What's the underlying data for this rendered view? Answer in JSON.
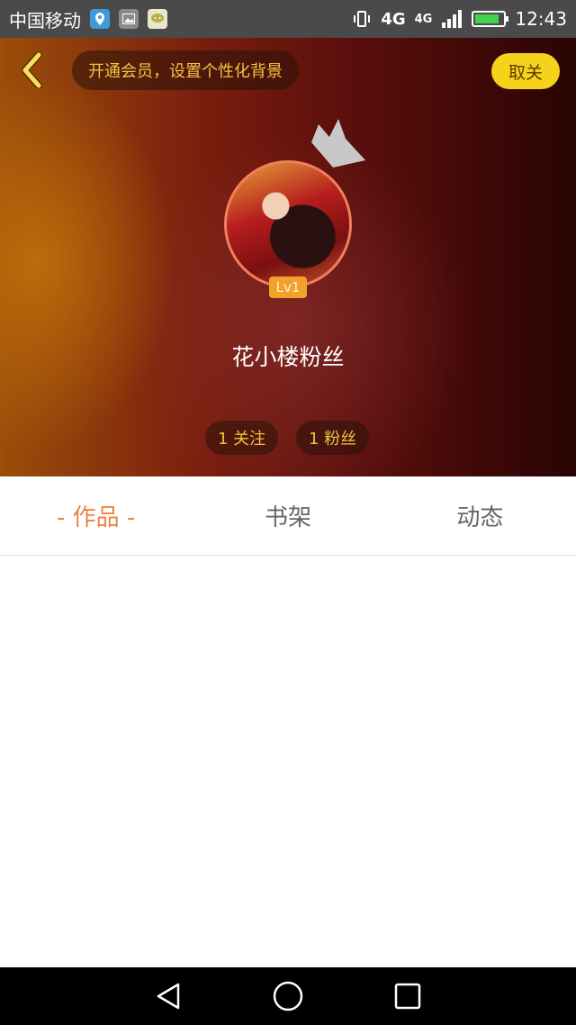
{
  "status_bar": {
    "carrier": "中国移动",
    "network_1": "4G",
    "network_2": "4G",
    "time": "12:43",
    "icons": [
      "maps-icon",
      "gallery-icon",
      "chat-icon",
      "vibrate-icon",
      "signal-icon",
      "battery-icon"
    ]
  },
  "header": {
    "vip_banner": "开通会员，设置个性化背景",
    "unfollow_label": "取关",
    "level": "Lv1",
    "username": "花小楼粉丝",
    "following": "1 关注",
    "fans": "1 粉丝"
  },
  "tabs": [
    {
      "label": "- 作品 -",
      "active": true
    },
    {
      "label": "书架",
      "active": false
    },
    {
      "label": "动态",
      "active": false
    }
  ],
  "colors": {
    "accent_tab": "#f0804a",
    "vip_text": "#f5c242",
    "unfollow_bg": "#f7d21a",
    "level_badge": "#f3a12a"
  }
}
